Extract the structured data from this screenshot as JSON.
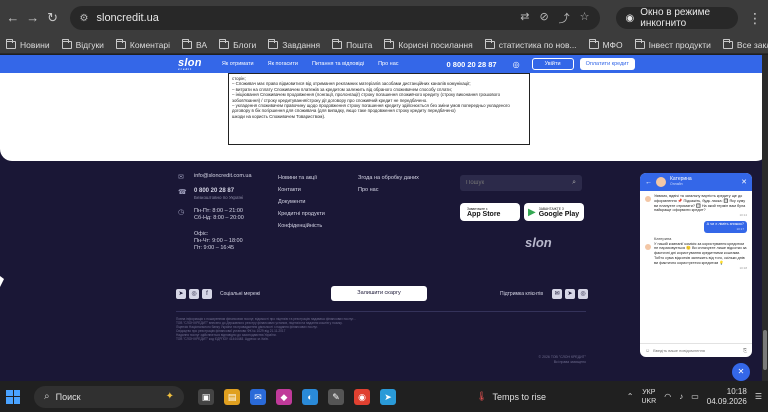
{
  "browser": {
    "url": "sloncredit.ua",
    "incognito_label": "Окно в режиме инкогнито"
  },
  "bookmarks": {
    "items": [
      "Новини",
      "Відгуки",
      "Коментарі",
      "ВА",
      "Блоги",
      "Завдання",
      "Пошта",
      "Корисні посилання",
      "статистика по нов...",
      "МФО",
      "Інвест продукти"
    ],
    "all_label": "Все закладки"
  },
  "site_header": {
    "logo": "slon",
    "logo_sub": "credit",
    "nav": [
      "Як отримати",
      "Як погасити",
      "Питання та відповіді",
      "Про нас"
    ],
    "phone": "0 800 20 28 87",
    "login_label": "Увійти",
    "apply_label": "Оплатити кредит"
  },
  "terms": {
    "lines": [
      "сторін;",
      "– Споживач має право відмовитися від отримання рекламних матеріалів засобами дистанційних каналів комунікації;",
      "– витрати на сплату Споживачем платежів за кредитом залежить від обраного споживачем способу сплати;",
      "– ініціювання Споживачем продовження (лонгації, пролонгації) строку погашення споживчого кредиту (строку виконання грошового зобов'язання) / строку кредитування/строку дії договору про споживчий кредит не передбачено.",
      "– укладення споживачем правочину щодо продовження строку погашення кредиту здійснюється без зміни умов попередньо укладеного договору в бік погіршення для споживача (для випадку, якщо таке продовження строку кредиту передбачено)",
      "шкоди на користь Споживачем Товариством)."
    ]
  },
  "footer": {
    "email": "info@sloncredit.com.ua",
    "phone": "0 800 20 28 87",
    "phone_note": "Безкоштовно по Україні",
    "hours_label1": "Пн-Пт: 8:00 – 21:00",
    "hours_label2": "Сб-Нд: 8:00 – 20:00",
    "office_label": "Офіс:",
    "office_hours1": "Пн-Чт: 9:00 – 18:00",
    "office_hours2": "Пт: 9:00 – 16:45",
    "links_col1": [
      "Новини та акції",
      "Контакти",
      "Документи",
      "Кредитні продукти",
      "Конфіденційність"
    ],
    "links_col2": [
      "Згода на обробку даних",
      "Про нас"
    ],
    "search_placeholder": "Пошук",
    "app_store_small": "Завантажте з",
    "app_store_big": "App Store",
    "google_play_small": "ЗАВАНТАЖТЕ З",
    "google_play_big": "Google Play",
    "slon_brand": "slon",
    "social_label": "Соціальні мережі",
    "review_label": "Залишити скаргу",
    "support_label": "Підтримка клієнтів",
    "legal": [
      "Повна інформація з поширенням фінансових послуг, відомості про ліцензію та реєстрацію надавача фінансових послуг...",
      "ТОВ \"СЛОН КРЕДИТ\" внесено до Державного реєстру фінансових установ, ліцензія на надання коштів у позику.",
      "Ліцензія Національного банку України на провадження діяльності з надання фінансових послуг.",
      "Свідоцтво про реєстрацію фінансової установи ФК № 1029 від 21.11.2017",
      "Надання послуг здійснюється відповідно до законодавства України.",
      "ТОВ \"СЛОН КРЕДИТ\" код ЄДРПОУ 41444448. Адреса: м. Київ."
    ],
    "copyright_line1": "© 2026 ТОВ \"СЛОН КРЕДИТ\"",
    "copyright_line2": "Всі права захищено"
  },
  "chat": {
    "agent_name": "Катерина",
    "agent_status": "Онлайн",
    "messages": [
      {
        "dir": "in",
        "text": "Уявимо, вдвічі та загальну вартість кредиту ще до оформлення 📌 Підкажіть, будь ласка: 🔲 Яку суму ви плануєте отримати? 🔲 На який термін вам була найкраще оформити кредит?",
        "time": "10:14"
      },
      {
        "dir": "out",
        "text": "А чи є ліміть знижок?",
        "time": "10:17"
      },
      {
        "dir": "in",
        "name": "Катерина",
        "text": "У нашій компанії комісія за користування кредитом не нараховується 🙂 Ви сплачуєте лише відсотки за фактичні дні користування кредитними коштами. Тобто сума відсотків залежить від того, скільки днів ви фактично користуєтеся кредитом 💡",
        "time": "10:18"
      }
    ],
    "input_placeholder": "Введіть ваше повідомлення"
  },
  "taskbar": {
    "search_label": "Поиск",
    "weather_label": "Temps to rise",
    "lang_top": "УКР",
    "lang_bottom": "UKR",
    "time": "10:18",
    "date": "04.09.2026"
  },
  "colors": {
    "brand_blue": "#3467e8",
    "footer_bg": "#1a1736"
  }
}
